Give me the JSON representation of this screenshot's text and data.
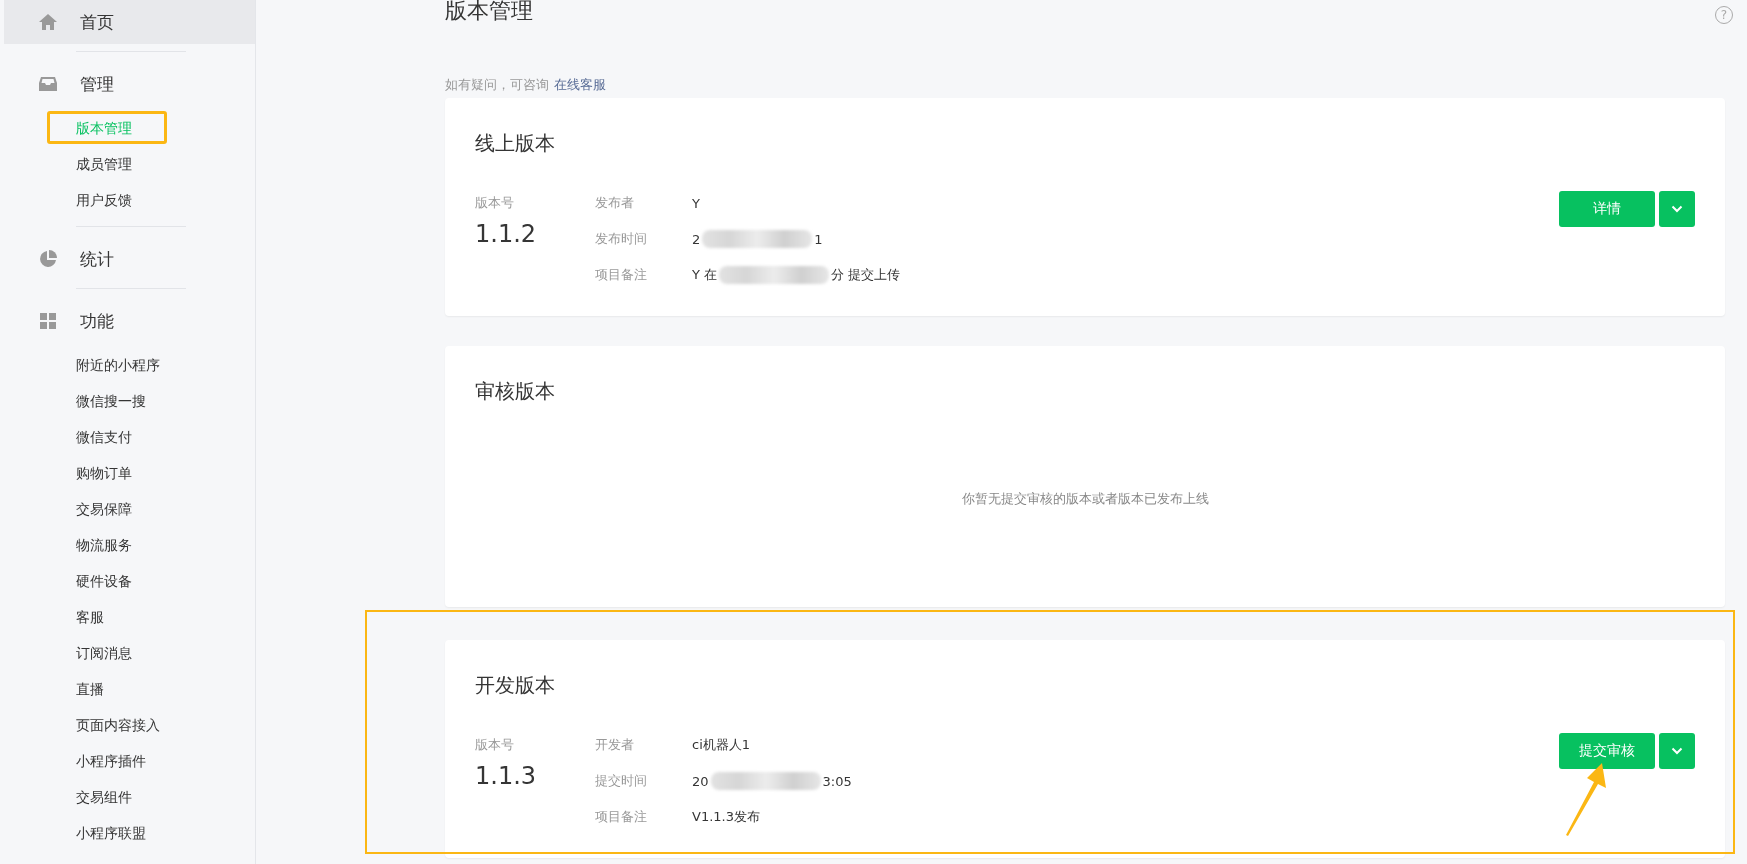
{
  "sidebar": {
    "groups": [
      {
        "label": "首页",
        "hovered": true
      },
      {
        "label": "管理",
        "hovered": false,
        "children": [
          {
            "label": "版本管理",
            "selected": true,
            "annotated": true
          },
          {
            "label": "成员管理",
            "selected": false,
            "annotated": false
          },
          {
            "label": "用户反馈",
            "selected": false,
            "annotated": false
          }
        ]
      },
      {
        "label": "统计",
        "hovered": false
      },
      {
        "label": "功能",
        "hovered": false,
        "children": [
          {
            "label": "附近的小程序",
            "selected": false,
            "annotated": false
          },
          {
            "label": "微信搜一搜",
            "selected": false,
            "annotated": false
          },
          {
            "label": "微信支付",
            "selected": false,
            "annotated": false
          },
          {
            "label": "购物订单",
            "selected": false,
            "annotated": false
          },
          {
            "label": "交易保障",
            "selected": false,
            "annotated": false
          },
          {
            "label": "物流服务",
            "selected": false,
            "annotated": false
          },
          {
            "label": "硬件设备",
            "selected": false,
            "annotated": false
          },
          {
            "label": "客服",
            "selected": false,
            "annotated": false
          },
          {
            "label": "订阅消息",
            "selected": false,
            "annotated": false
          },
          {
            "label": "直播",
            "selected": false,
            "annotated": false
          },
          {
            "label": "页面内容接入",
            "selected": false,
            "annotated": false
          },
          {
            "label": "小程序插件",
            "selected": false,
            "annotated": false
          },
          {
            "label": "交易组件",
            "selected": false,
            "annotated": false
          },
          {
            "label": "小程序联盟",
            "selected": false,
            "annotated": false
          }
        ]
      }
    ]
  },
  "page": {
    "title": "版本管理",
    "help": "?",
    "hint": "如有疑问，可咨询",
    "hint_link": "在线客服"
  },
  "cards": [
    {
      "kind": "version",
      "title": "线上版本",
      "annotated": false,
      "arrow": false,
      "version_label": "版本号",
      "version": "1.1.2",
      "rows": [
        {
          "label": "发布者",
          "value": "Y",
          "redacted": false
        },
        {
          "label": "发布时间",
          "value": "2",
          "value_end": "1",
          "redacted": true
        },
        {
          "label": "项目备注",
          "value": "Y 在",
          "value_end": "分 提交上传",
          "redacted": true
        }
      ],
      "button": "详情"
    },
    {
      "kind": "empty",
      "title": "审核版本",
      "annotated": false,
      "arrow": false,
      "message": "你暂无提交审核的版本或者版本已发布上线"
    },
    {
      "kind": "version",
      "title": "开发版本",
      "annotated": true,
      "arrow": true,
      "version_label": "版本号",
      "version": "1.1.3",
      "rows": [
        {
          "label": "开发者",
          "value": "ci机器人1",
          "redacted": false
        },
        {
          "label": "提交时间",
          "value": "20",
          "value_end": "3:05",
          "redacted": true
        },
        {
          "label": "项目备注",
          "value": "V1.1.3发布",
          "redacted": false
        }
      ],
      "button": "提交审核"
    }
  ]
}
